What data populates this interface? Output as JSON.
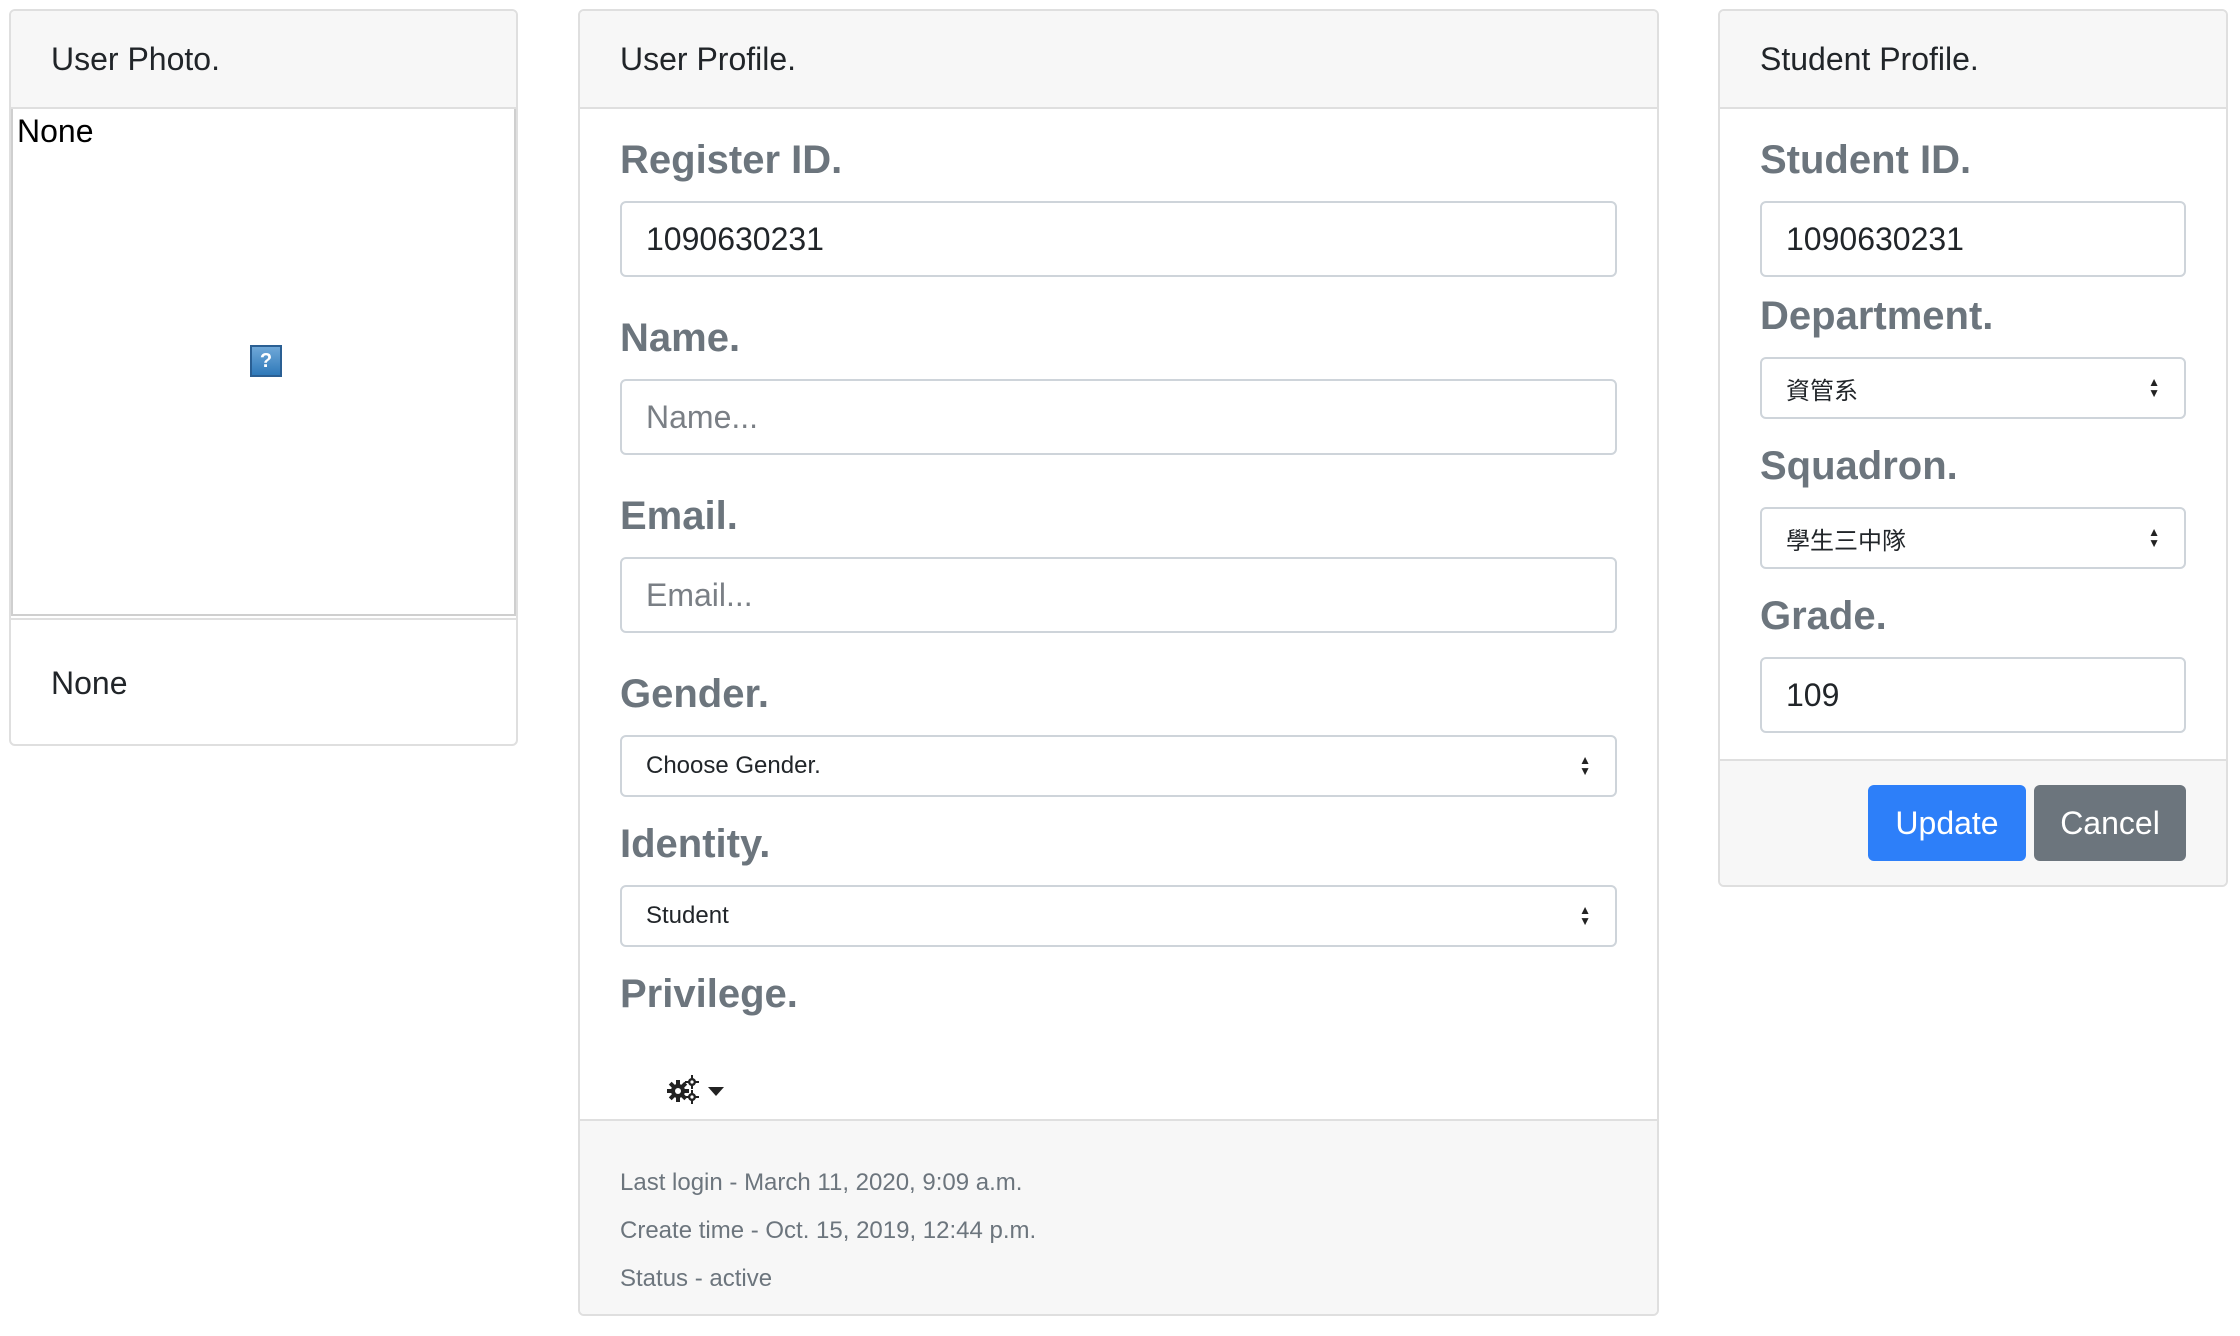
{
  "photo_card": {
    "header": "User Photo.",
    "image_alt": "None",
    "footer_text": "None"
  },
  "profile_card": {
    "header": "User Profile.",
    "fields": {
      "register_id": {
        "label": "Register ID.",
        "value": "1090630231"
      },
      "name": {
        "label": "Name.",
        "placeholder": "Name..."
      },
      "email": {
        "label": "Email.",
        "placeholder": "Email..."
      },
      "gender": {
        "label": "Gender.",
        "selected": "Choose Gender."
      },
      "identity": {
        "label": "Identity.",
        "selected": "Student"
      },
      "privilege": {
        "label": "Privilege.",
        "icon": "gears-icon"
      }
    },
    "footer": {
      "last_login": "Last login - March 11, 2020, 9:09 a.m.",
      "create_time": "Create time - Oct. 15, 2019, 12:44 p.m.",
      "status": "Status - active"
    }
  },
  "student_card": {
    "header": "Student Profile.",
    "fields": {
      "student_id": {
        "label": "Student ID.",
        "value": "1090630231"
      },
      "department": {
        "label": "Department.",
        "selected": "資管系"
      },
      "squadron": {
        "label": "Squadron.",
        "selected": "學生三中隊"
      },
      "grade": {
        "label": "Grade.",
        "value": "109"
      }
    },
    "buttons": {
      "update": "Update",
      "cancel": "Cancel"
    }
  },
  "colors": {
    "primary": "#2d7ff9",
    "secondary": "#6c757d",
    "label": "#6c757d",
    "header_bg": "#f7f7f7"
  }
}
